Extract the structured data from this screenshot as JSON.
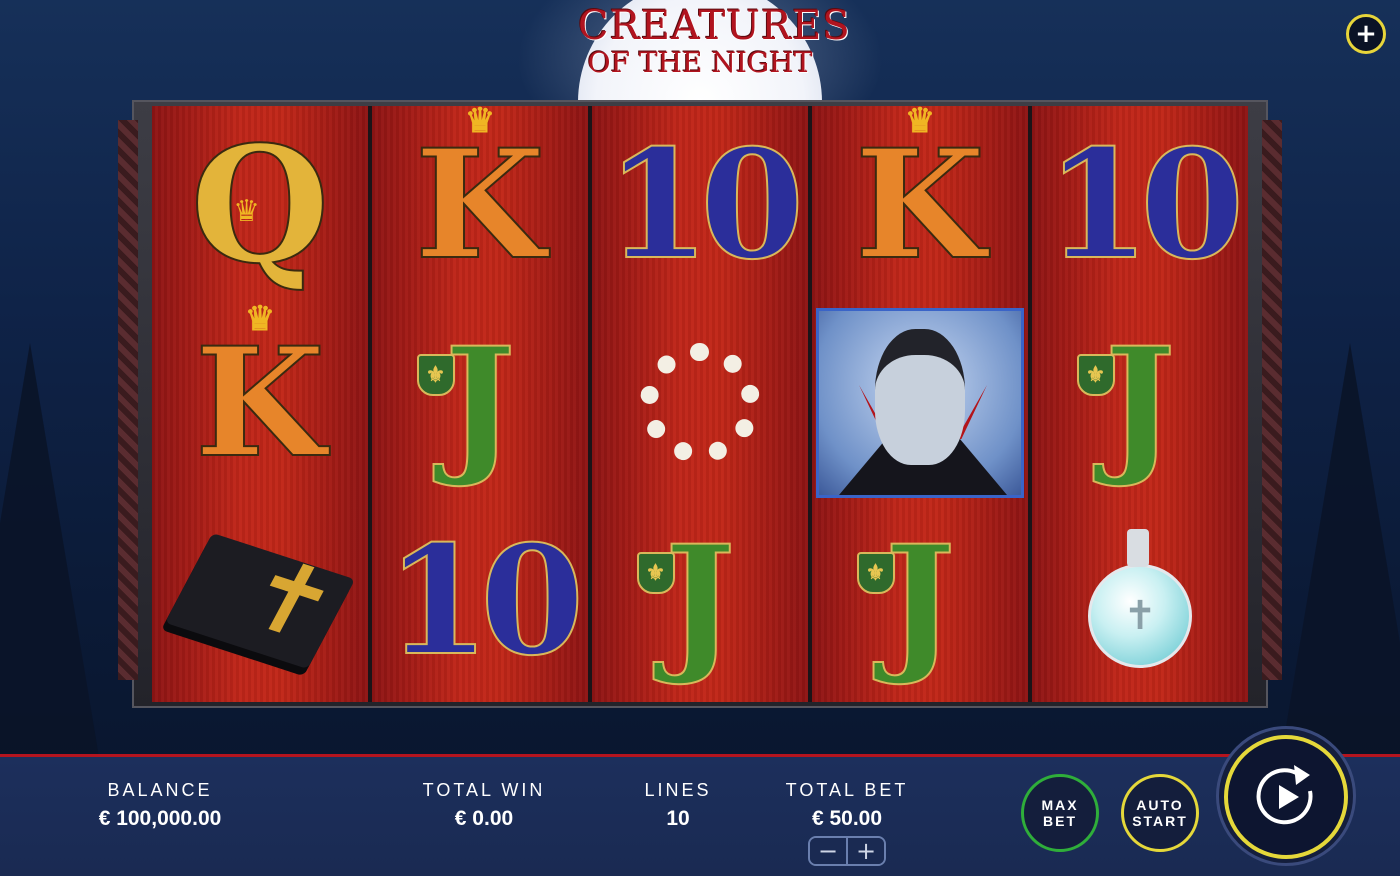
{
  "game": {
    "title_line1": "CREATURES",
    "title_line2": "OF THE NIGHT"
  },
  "menu": {
    "icon": "plus-icon",
    "label": "+"
  },
  "reels": [
    [
      "Q",
      "K",
      "holy-bible"
    ],
    [
      "K",
      "J",
      "10"
    ],
    [
      "10",
      "garlic",
      "J"
    ],
    [
      "K",
      "vampire",
      "J"
    ],
    [
      "10",
      "J",
      "holy-water"
    ]
  ],
  "symbols": {
    "Q": {
      "text": "Q",
      "ornament": "crown"
    },
    "K": {
      "text": "K",
      "ornament": "crown"
    },
    "J": {
      "text": "J",
      "ornament": "fleur-de-lis"
    },
    "10": {
      "text": "10"
    },
    "holy-bible": {
      "label": "HOLY BIBLE"
    },
    "garlic": {},
    "vampire": {},
    "holy-water": {}
  },
  "status": {
    "balance_label": "BALANCE",
    "balance_value": "€ 100,000.00",
    "total_win_label": "TOTAL WIN",
    "total_win_value": "€ 0.00",
    "lines_label": "LINES",
    "lines_value": "10",
    "total_bet_label": "TOTAL BET",
    "total_bet_value": "€ 50.00"
  },
  "controls": {
    "bet_minus": "−",
    "bet_plus": "+",
    "max_bet_line1": "MAX",
    "max_bet_line2": "BET",
    "auto_start_line1": "AUTO",
    "auto_start_line2": "START",
    "spin_icon": "spin-play-icon"
  },
  "colors": {
    "accent_yellow": "#e5d83a",
    "max_bet_ring": "#2fae3a",
    "auto_start_ring": "#e5d83a",
    "reel_red": "#c02619",
    "bar_blue": "#1c2f5c",
    "bar_border_red": "#b5141e"
  }
}
